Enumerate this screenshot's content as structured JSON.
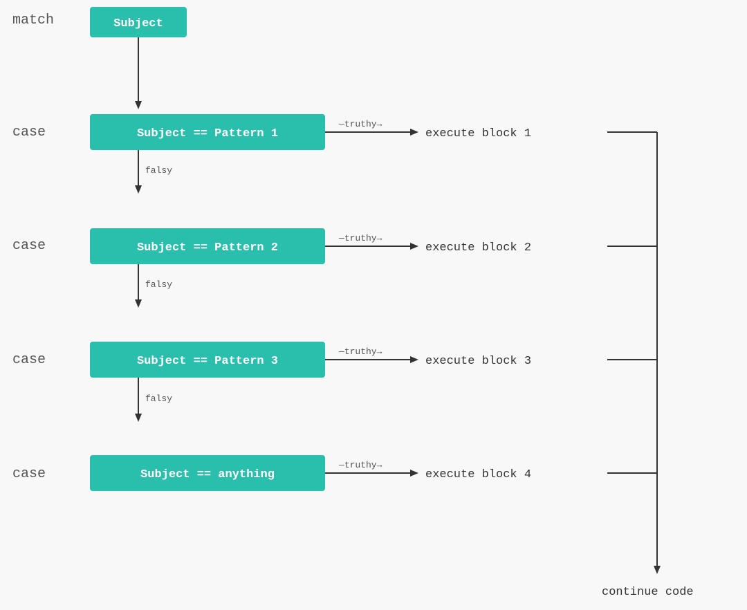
{
  "diagram": {
    "match_label": "match",
    "subject_box": "Subject",
    "cases": [
      {
        "case_label": "case",
        "box_text": "Subject == Pattern 1",
        "truthy_label": "truthy",
        "block_label": "execute block 1"
      },
      {
        "case_label": "case",
        "box_text": "Subject == Pattern 2",
        "truthy_label": "truthy",
        "block_label": "execute block 2"
      },
      {
        "case_label": "case",
        "box_text": "Subject == Pattern 3",
        "truthy_label": "truthy",
        "block_label": "execute block 3"
      },
      {
        "case_label": "case",
        "box_text": "Subject == anything",
        "truthy_label": "truthy",
        "block_label": "execute block 4"
      }
    ],
    "falsy_label": "falsy",
    "continue_label": "continue code"
  }
}
